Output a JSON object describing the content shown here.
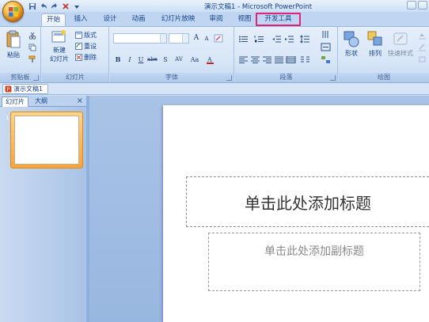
{
  "window": {
    "title": "演示文稿1 - Microsoft PowerPoint"
  },
  "quick_access": {
    "icons": [
      "save-icon",
      "undo-icon",
      "redo-icon",
      "close-icon",
      "customize-icon"
    ]
  },
  "ribbon_tabs": [
    {
      "label": "开始",
      "active": true
    },
    {
      "label": "插入",
      "active": false
    },
    {
      "label": "设计",
      "active": false
    },
    {
      "label": "动画",
      "active": false
    },
    {
      "label": "幻灯片放映",
      "active": false
    },
    {
      "label": "审阅",
      "active": false
    },
    {
      "label": "视图",
      "active": false
    },
    {
      "label": "开发工具",
      "active": false,
      "highlighted": true
    }
  ],
  "ribbon": {
    "clipboard": {
      "label": "剪贴板",
      "paste": "粘贴"
    },
    "slides": {
      "label": "幻灯片",
      "new_slide": "新建",
      "new_slide_line2": "幻灯片",
      "layout": "版式",
      "reset": "重设",
      "delete": "删除"
    },
    "font": {
      "label": "字体",
      "bold": "B",
      "italic": "I",
      "underline": "U",
      "strike": "abe",
      "shadow": "S",
      "spacing": "AV",
      "case": "Aa",
      "grow": "A",
      "shrink": "A"
    },
    "paragraph": {
      "label": "段落"
    },
    "drawing": {
      "label": "绘图",
      "shapes": "形状",
      "arrange": "排列",
      "quick_styles": "快速样式"
    }
  },
  "document_tab": {
    "label": "演示文稿1"
  },
  "left_pane": {
    "tab_slides": "幻灯片",
    "tab_outline": "大纲",
    "close": "×",
    "slide_number": "1"
  },
  "slide": {
    "title_placeholder": "单击此处添加标题",
    "subtitle_placeholder": "单击此处添加副标题"
  },
  "colors": {
    "accent_highlight": "#e0247a",
    "ribbon_text": "#15428b",
    "thumbnail_selected": "#f7a43c"
  }
}
